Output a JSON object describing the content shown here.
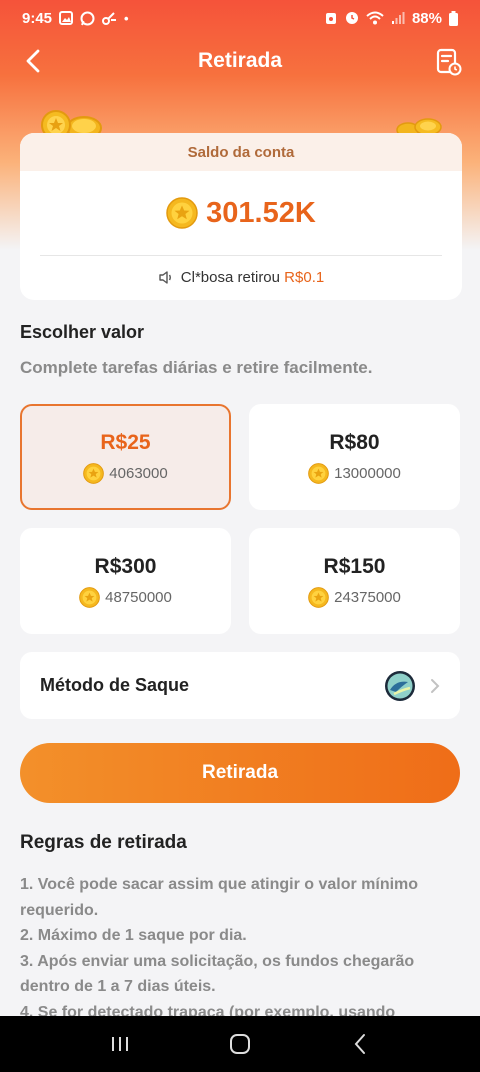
{
  "status_bar": {
    "time": "9:45",
    "battery": "88%"
  },
  "header": {
    "title": "Retirada",
    "back_icon": "chevron-left-icon",
    "history_icon": "history-record-icon"
  },
  "balance": {
    "label": "Saldo da conta",
    "amount": "301.52K",
    "ticker_text": "Cl*bosa retirou ",
    "ticker_amount": "R$0.1"
  },
  "choose": {
    "title": "Escolher valor",
    "subtitle": "Complete tarefas diárias e retire facilmente."
  },
  "amounts": [
    {
      "value": "R$25",
      "coins": "4063000",
      "selected": true
    },
    {
      "value": "R$80",
      "coins": "13000000",
      "selected": false
    },
    {
      "value": "R$300",
      "coins": "48750000",
      "selected": false
    },
    {
      "value": "R$150",
      "coins": "24375000",
      "selected": false
    }
  ],
  "method": {
    "label": "Método de Saque",
    "icon": "pix-payment-icon"
  },
  "withdraw_button": "Retirada",
  "rules": {
    "title": "Regras de retirada",
    "items": [
      "1. Você pode sacar assim que atingir o valor mínimo requerido.",
      "2. Máximo de 1 saque por dia.",
      "3. Após enviar uma solicitação, os fundos chegarão dentro de 1 a 7 dias úteis.",
      "4. Se for detectado trapaça (por exemplo, usando"
    ]
  },
  "colors": {
    "accent": "#e8641b",
    "button": "#ef7a1f",
    "header_top": "#f5533a"
  }
}
